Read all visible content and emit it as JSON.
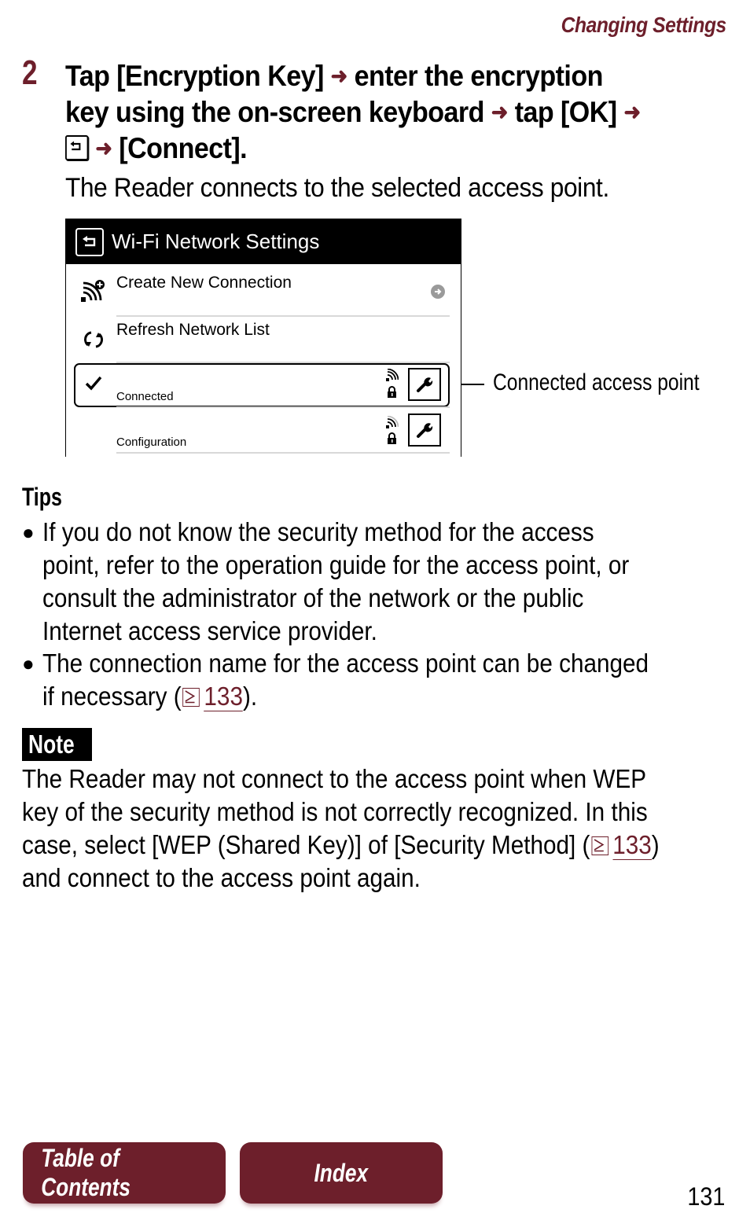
{
  "header": {
    "section_title": "Changing Settings"
  },
  "step": {
    "number": "2",
    "line1_a": "Tap [Encryption Key]",
    "line1_b": "enter the encryption",
    "line2_a": "key using the on-screen keyboard",
    "line2_b": "tap [OK]",
    "line3": "[Connect].",
    "description": "The Reader connects to the selected access point."
  },
  "device_screen": {
    "title": "Wi-Fi Network Settings",
    "items": [
      {
        "label": "Create New Connection",
        "icon": "wifi-add-icon",
        "trailing": "arrow-right-circle-icon"
      },
      {
        "label": "Refresh Network List",
        "icon": "refresh-icon"
      }
    ],
    "networks": [
      {
        "sublabel": "Connected",
        "selected": true,
        "icons": [
          "checkmark-icon",
          "wifi-signal-icon",
          "lock-icon",
          "wrench-icon"
        ]
      },
      {
        "sublabel": "Configuration",
        "selected": false,
        "icons": [
          "wifi-signal-icon",
          "lock-icon",
          "wrench-icon"
        ]
      }
    ]
  },
  "callout": {
    "label": "Connected access point"
  },
  "tips": {
    "title": "Tips",
    "items": [
      {
        "lines": [
          "If you do not know the security method for the access",
          "point, refer to the operation guide for the access point, or",
          "consult the administrator of the network or the public",
          "Internet access service provider."
        ]
      },
      {
        "lines": [
          "The connection name for the access point can be changed"
        ],
        "last_prefix": "if necessary (",
        "ref_page": "133",
        "last_suffix": ")."
      }
    ]
  },
  "note": {
    "title": "Note",
    "lines": [
      "The Reader may not connect to the access point when WEP",
      "key of the security method is not correctly recognized. In this"
    ],
    "line3_prefix": "case, select [WEP (Shared Key)] of [Security Method] (",
    "ref_page": "133",
    "line3_suffix": ")",
    "line4": "and connect to the access point again."
  },
  "footer": {
    "toc_label": "Table of Contents",
    "index_label": "Index",
    "page_number": "131"
  },
  "colors": {
    "accent": "#6d1f2b"
  }
}
